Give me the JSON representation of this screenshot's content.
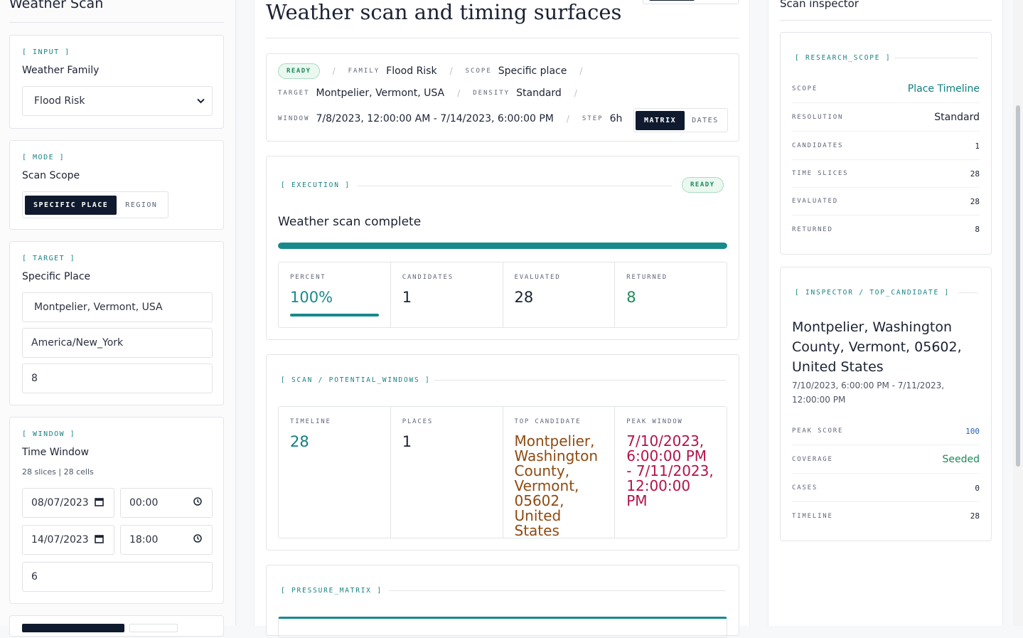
{
  "left": {
    "title": "Weather Scan",
    "input_card": {
      "tag": "[ INPUT ]",
      "label": "Weather Family",
      "selected": "Flood Risk"
    },
    "mode_card": {
      "tag": "[ MODE ]",
      "label": "Scan Scope",
      "options": [
        "SPECIFIC PLACE",
        "REGION"
      ],
      "active": "SPECIFIC PLACE"
    },
    "target_card": {
      "tag": "[ TARGET ]",
      "label": "Specific Place",
      "place": "Montpelier, Vermont, USA",
      "timezone": "America/New_York",
      "count": "8"
    },
    "window_card": {
      "tag": "[ WINDOW ]",
      "label": "Time Window",
      "sub": "28 slices | 28 cells",
      "start_date": "08/07/2023",
      "start_time": "00:00",
      "end_date": "14/07/2023",
      "end_time": "18:00",
      "step": "6"
    }
  },
  "main": {
    "title": "Weather scan and timing surfaces",
    "summary": {
      "status": "READY",
      "family_key": "FAMILY",
      "family": "Flood Risk",
      "scope_key": "SCOPE",
      "scope": "Specific place",
      "target_key": "TARGET",
      "target": "Montpelier, Vermont, USA",
      "density_key": "DENSITY",
      "density": "Standard",
      "window_key": "WINDOW",
      "window": "7/8/2023, 12:00:00 AM - 7/14/2023, 6:00:00 PM",
      "step_key": "STEP",
      "step": "6h",
      "view_options": [
        "MATRIX",
        "DATES"
      ],
      "view_active": "MATRIX"
    },
    "execution": {
      "tag": "[ EXECUTION ]",
      "status": "READY",
      "heading": "Weather scan complete",
      "progress": 1.0,
      "stats": [
        {
          "key": "PERCENT",
          "value": "100%"
        },
        {
          "key": "CANDIDATES",
          "value": "1"
        },
        {
          "key": "EVALUATED",
          "value": "28"
        },
        {
          "key": "RETURNED",
          "value": "8"
        }
      ]
    },
    "scan": {
      "tag": "[ SCAN / POTENTIAL_WINDOWS ]",
      "stats": [
        {
          "key": "TIMELINE",
          "value": "28"
        },
        {
          "key": "PLACES",
          "value": "1"
        },
        {
          "key": "TOP CANDIDATE",
          "value": "Montpelier, Washington County, Vermont, 05602, United States"
        },
        {
          "key": "PEAK WINDOW",
          "value": "7/10/2023, 6:00:00 PM - 7/11/2023, 12:00:00 PM"
        }
      ]
    },
    "pressure": {
      "tag": "[ PRESSURE_MATRIX ]"
    }
  },
  "right": {
    "title": "Scan inspector",
    "research": {
      "tag": "[ RESEARCH_SCOPE ]",
      "rows": [
        {
          "key": "SCOPE",
          "value": "Place Timeline"
        },
        {
          "key": "RESOLUTION",
          "value": "Standard"
        },
        {
          "key": "CANDIDATES",
          "value": "1"
        },
        {
          "key": "TIME SLICES",
          "value": "28"
        },
        {
          "key": "EVALUATED",
          "value": "28"
        },
        {
          "key": "RETURNED",
          "value": "8"
        }
      ]
    },
    "inspector": {
      "tag": "[ INSPECTOR / TOP_CANDIDATE ]",
      "place": "Montpelier, Washington County, Vermont, 05602, United States",
      "window": "7/10/2023, 6:00:00 PM - 7/11/2023, 12:00:00 PM",
      "rows": [
        {
          "key": "PEAK SCORE",
          "value": "100"
        },
        {
          "key": "COVERAGE",
          "value": "Seeded"
        },
        {
          "key": "CASES",
          "value": "0"
        },
        {
          "key": "TIMELINE",
          "value": "28"
        }
      ]
    }
  },
  "colors": {
    "accent": "#178a8c",
    "dark": "#0f1a2e",
    "ready_green": "#1c8a5a",
    "candidate_brown": "#8f4a10",
    "peak_red": "#b3124a",
    "link_teal": "#0f7e80",
    "score_blue": "#2a5bb8"
  }
}
